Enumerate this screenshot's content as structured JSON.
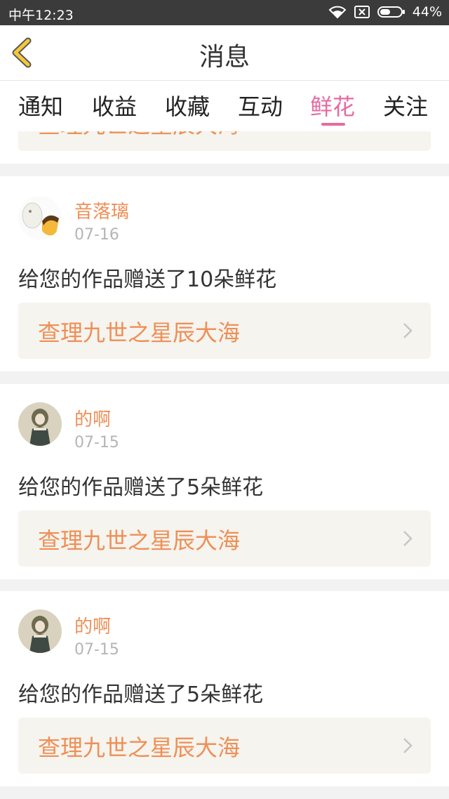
{
  "status": {
    "time": "中午12:23",
    "battery": "44%"
  },
  "header": {
    "title": "消息"
  },
  "tabs": [
    "通知",
    "收益",
    "收藏",
    "互动",
    "鲜花",
    "关注"
  ],
  "active_tab_index": 4,
  "partial_card": {
    "link": "查理九世之星辰大海"
  },
  "messages": [
    {
      "user": "音落璃",
      "date": "07-16",
      "text": "给您的作品赠送了10朵鲜花",
      "link": "查理九世之星辰大海"
    },
    {
      "user": "的啊",
      "date": "07-15",
      "text": "给您的作品赠送了5朵鲜花",
      "link": "查理九世之星辰大海"
    },
    {
      "user": "的啊",
      "date": "07-15",
      "text": "给您的作品赠送了5朵鲜花",
      "link": "查理九世之星辰大海"
    }
  ],
  "colors": {
    "accent": "#e76aa0",
    "link": "#ef8f57",
    "statusbar": "#3b3b3b",
    "back_chevron": "#f5c83a"
  },
  "icons": [
    "wifi-icon",
    "sim-icon",
    "battery-icon",
    "back-chevron-icon",
    "chevron-right-icon",
    "avatar"
  ]
}
